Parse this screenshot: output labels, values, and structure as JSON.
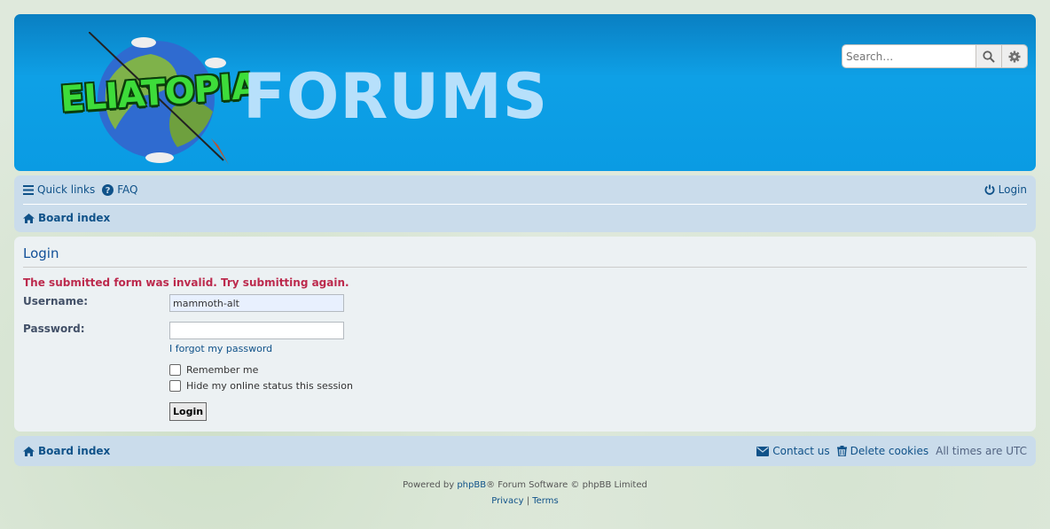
{
  "header": {
    "logo_text": "ELIATOPIA",
    "title": "FORUMS",
    "search_placeholder": "Search…"
  },
  "nav": {
    "quick_links": "Quick links",
    "faq": "FAQ",
    "login": "Login",
    "board_index": "Board index"
  },
  "login_panel": {
    "heading": "Login",
    "error": "The submitted form was invalid. Try submitting again.",
    "username_label": "Username:",
    "username_value": "mammoth-alt",
    "password_label": "Password:",
    "forgot_link": "I forgot my password",
    "remember_me": "Remember me",
    "hide_status": "Hide my online status this session",
    "submit_label": "Login"
  },
  "footer_nav": {
    "board_index": "Board index",
    "contact": "Contact us",
    "delete_cookies": "Delete cookies",
    "timezone": "All times are UTC"
  },
  "copyright": {
    "powered_by": "Powered by",
    "phpbb": "phpBB",
    "suffix": "® Forum Software © phpBB Limited",
    "privacy": "Privacy",
    "separator": "|",
    "terms": "Terms"
  },
  "colors": {
    "header_blue": "#0ea0e6",
    "nav_bg": "#cadceb",
    "link": "#105289",
    "error": "#bc2a4d"
  }
}
